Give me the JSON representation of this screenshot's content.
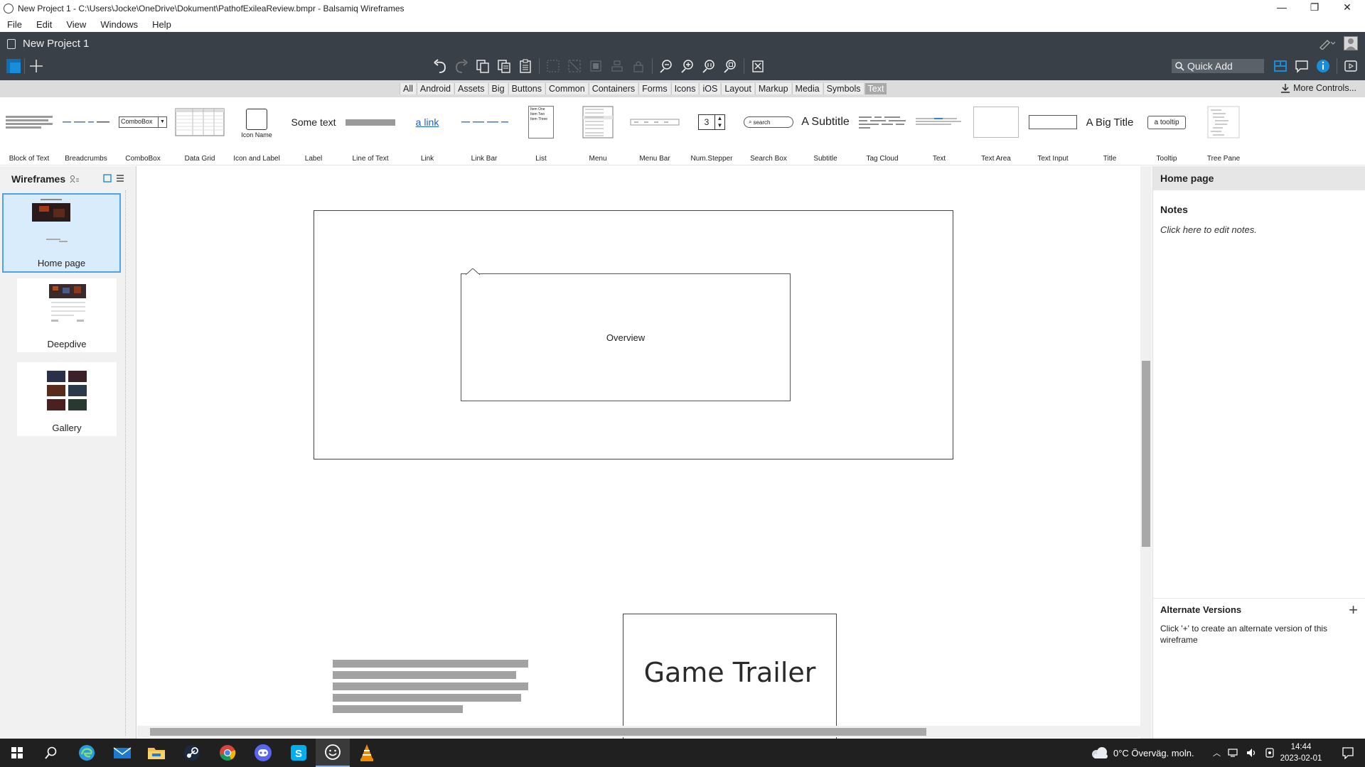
{
  "window": {
    "title": "New Project 1 - C:\\Users\\Jocke\\OneDrive\\Dokument\\PathofExileaReview.bmpr - Balsamiq Wireframes",
    "controls": [
      "—",
      "❐",
      "✕"
    ]
  },
  "menu": [
    "File",
    "Edit",
    "View",
    "Windows",
    "Help"
  ],
  "header": {
    "project_title": "New Project 1",
    "quick_add_placeholder": "Quick Add"
  },
  "categories": {
    "items": [
      "All",
      "Android",
      "Assets",
      "Big",
      "Buttons",
      "Common",
      "Containers",
      "Forms",
      "Icons",
      "iOS",
      "Layout",
      "Markup",
      "Media",
      "Symbols",
      "Text"
    ],
    "active": "Text",
    "more_controls": "More Controls..."
  },
  "library": {
    "items": [
      "Block of Text",
      "Breadcrumbs",
      "ComboBox",
      "Data Grid",
      "Icon and Label",
      "Label",
      "Line of Text",
      "Link",
      "Link Bar",
      "List",
      "Menu",
      "Menu Bar",
      "Num.Stepper",
      "Search Box",
      "Subtitle",
      "Tag Cloud",
      "Text",
      "Text Area",
      "Text Input",
      "Title",
      "Tooltip",
      "Tree Pane"
    ],
    "previews": {
      "combobox": "ComboBox",
      "icon_name": "Icon Name",
      "label": "Some text",
      "link": "a link",
      "list_items": [
        "Item One",
        "Item Two",
        "Item Three"
      ],
      "stepper": "3",
      "search": "search",
      "subtitle": "A Subtitle",
      "title": "A Big Title",
      "tooltip": "a tooltip"
    }
  },
  "left_panel": {
    "title": "Wireframes",
    "pages": [
      "Home page",
      "Deepdive",
      "Gallery"
    ],
    "selected": "Home page"
  },
  "canvas": {
    "overview_label": "Overview",
    "trailer_label": "Game Trailer"
  },
  "right_panel": {
    "page_title": "Home page",
    "notes_heading": "Notes",
    "notes_placeholder": "Click here to edit notes.",
    "alt_heading": "Alternate Versions",
    "alt_desc": "Click '+' to create an alternate version of this wireframe"
  },
  "taskbar": {
    "weather": "0°C  Överväg. moln.",
    "time": "14:44",
    "date": "2023-02-01"
  },
  "colors": {
    "header_bg": "#3a4047",
    "accent_blue": "#1a8cd8",
    "selection": "#4aa3ef",
    "taskbar_bg": "#202020"
  }
}
